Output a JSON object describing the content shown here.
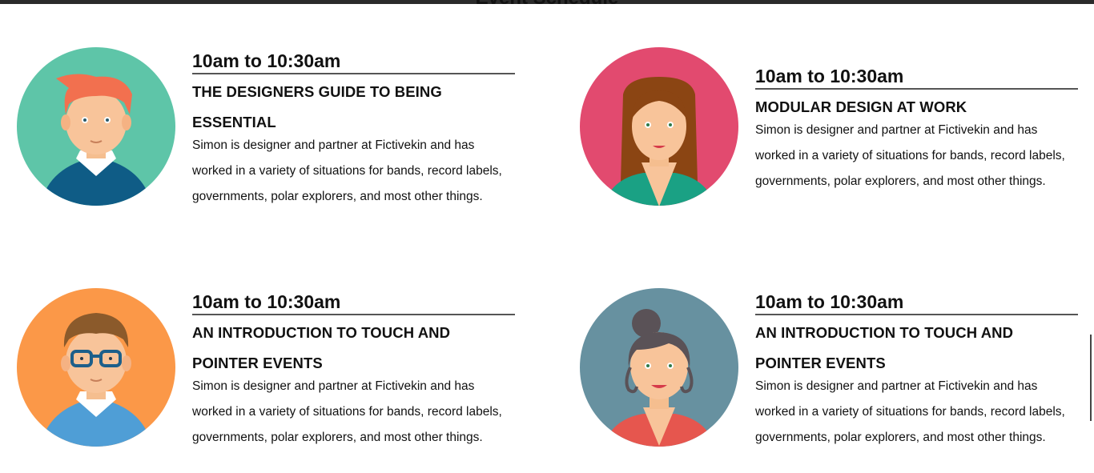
{
  "section": {
    "title": "Event Schedule"
  },
  "colors": {
    "avatar_1_bg": "#5ec5a8",
    "avatar_2_bg": "#e24a6f",
    "avatar_3_bg": "#fb9848",
    "avatar_4_bg": "#6791a0"
  },
  "events": [
    {
      "time": "10am to 10:30am",
      "title_line1": "THE DESIGNERS GUIDE TO BEING",
      "title_line2": "ESSENTIAL",
      "desc_line1": "Simon is designer and partner at Fictivekin and has",
      "desc_line2": "worked in a variety of situations for bands, record labels,",
      "desc_line3": "governments, polar explorers, and most other things.",
      "avatar": "man-red-hair-avatar"
    },
    {
      "time": "10am to 10:30am",
      "title_line1": "MODULAR DESIGN AT WORK",
      "desc_line1": "Simon is designer and partner at Fictivekin and has",
      "desc_line2": "worked in a variety of situations for bands, record labels,",
      "desc_line3": "governments, polar explorers, and most other things.",
      "avatar": "woman-brown-hair-avatar"
    },
    {
      "time": "10am to 10:30am",
      "title_line1": "AN INTRODUCTION TO TOUCH AND",
      "title_line2": "POINTER EVENTS",
      "desc_line1": "Simon is designer and partner at Fictivekin and has",
      "desc_line2": "worked in a variety of situations for bands, record labels,",
      "desc_line3": "governments, polar explorers, and most other things.",
      "avatar": "man-glasses-avatar"
    },
    {
      "time": "10am to 10:30am",
      "title_line1": "AN INTRODUCTION TO TOUCH AND",
      "title_line2": "POINTER EVENTS",
      "desc_line1": "Simon is designer and partner at Fictivekin and has",
      "desc_line2": "worked in a variety of situations for bands, record labels,",
      "desc_line3": "governments, polar explorers, and most other things.",
      "avatar": "woman-bun-hair-avatar"
    }
  ]
}
